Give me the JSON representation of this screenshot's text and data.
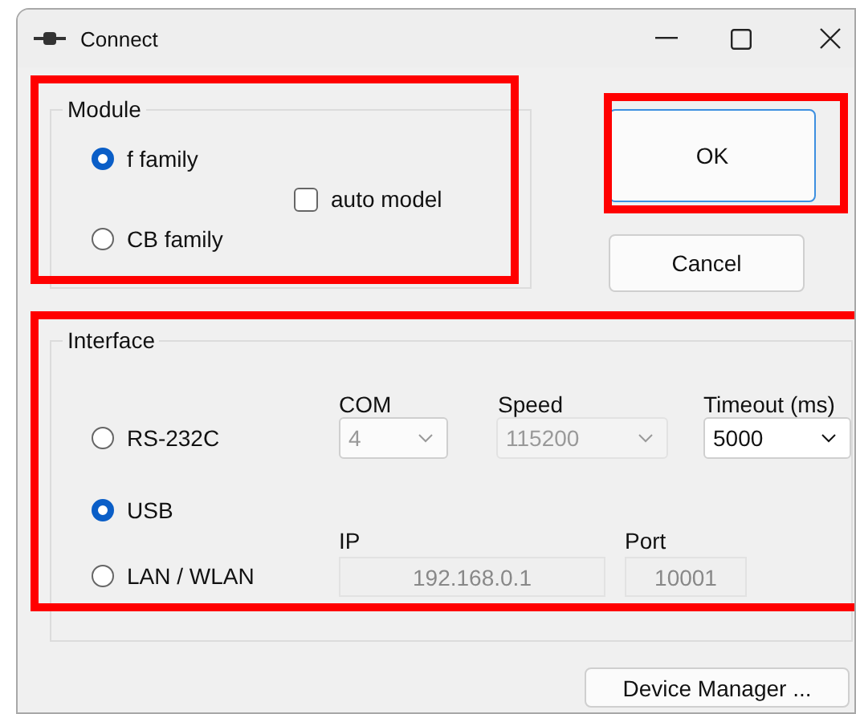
{
  "window": {
    "title": "Connect"
  },
  "module": {
    "label": "Module",
    "options": [
      {
        "label": "f family",
        "selected": true
      },
      {
        "label": "CB family",
        "selected": false
      }
    ],
    "auto_model": {
      "label": "auto model",
      "checked": false
    }
  },
  "buttons": {
    "ok": "OK",
    "cancel": "Cancel",
    "device_manager": "Device Manager ..."
  },
  "interface": {
    "label": "Interface",
    "options": [
      {
        "label": "RS-232C",
        "selected": false
      },
      {
        "label": "USB",
        "selected": true
      },
      {
        "label": "LAN / WLAN",
        "selected": false
      }
    ],
    "com": {
      "label": "COM",
      "value": "4",
      "disabled": true
    },
    "speed": {
      "label": "Speed",
      "value": "115200",
      "disabled": true
    },
    "timeout": {
      "label": "Timeout (ms)",
      "value": "5000",
      "disabled": false
    },
    "ip": {
      "label": "IP",
      "value": "192.168.0.1",
      "disabled": true
    },
    "port": {
      "label": "Port",
      "value": "10001",
      "disabled": true
    }
  },
  "highlights": [
    {
      "kind": "module"
    },
    {
      "kind": "ok"
    },
    {
      "kind": "interface"
    }
  ]
}
